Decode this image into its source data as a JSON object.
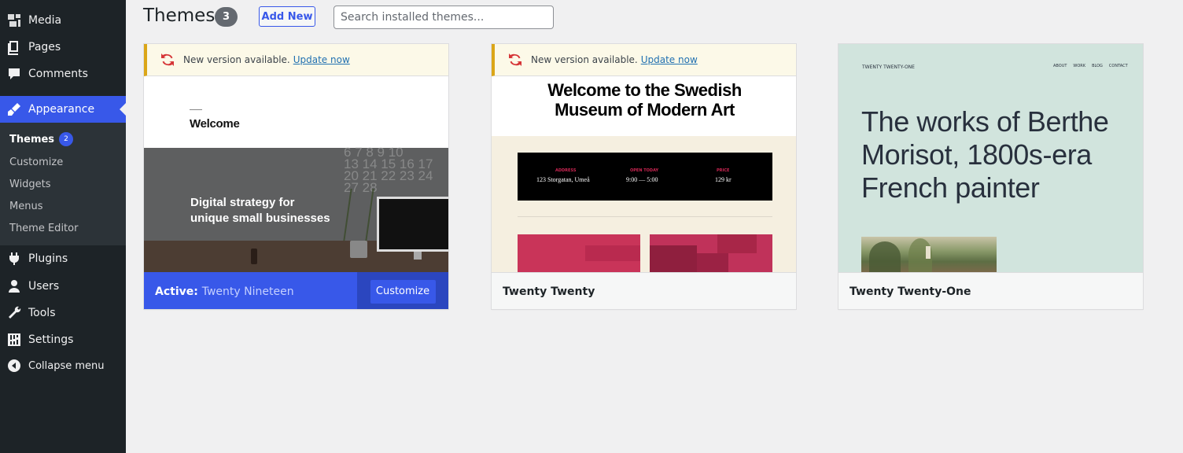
{
  "sidebar": {
    "items": [
      {
        "label": "Media",
        "icon": "media-icon"
      },
      {
        "label": "Pages",
        "icon": "pages-icon"
      },
      {
        "label": "Comments",
        "icon": "comments-icon"
      },
      {
        "label": "Appearance",
        "icon": "appearance-icon"
      },
      {
        "label": "Plugins",
        "icon": "plugins-icon"
      },
      {
        "label": "Users",
        "icon": "users-icon"
      },
      {
        "label": "Tools",
        "icon": "tools-icon"
      },
      {
        "label": "Settings",
        "icon": "settings-icon"
      },
      {
        "label": "Collapse menu",
        "icon": "collapse-icon"
      }
    ],
    "submenu": [
      {
        "label": "Themes",
        "badge": "2"
      },
      {
        "label": "Customize"
      },
      {
        "label": "Widgets"
      },
      {
        "label": "Menus"
      },
      {
        "label": "Theme Editor"
      }
    ]
  },
  "header": {
    "title": "Themes",
    "count": "3",
    "add_new": "Add New",
    "search_placeholder": "Search installed themes..."
  },
  "themes": [
    {
      "name": "Twenty Nineteen",
      "active_label": "Active:",
      "customize_label": "Customize",
      "notice_text": "New version available.",
      "notice_link": "Update now",
      "preview": {
        "heading": "Welcome",
        "hero_text_1": "Digital strategy for",
        "hero_text_2": "unique small businesses",
        "calendar_rows": [
          "6 7 8 9 10",
          "13 14 15 16 17",
          "20 21 22 23 24",
          "27 28"
        ]
      }
    },
    {
      "name": "Twenty Twenty",
      "notice_text": "New version available.",
      "notice_link": "Update now",
      "preview": {
        "heading_1": "Welcome to the Swedish",
        "heading_2": "Museum of Modern Art",
        "info_labels": [
          "ADDRESS",
          "OPEN TODAY",
          "PRICE"
        ],
        "info_values": [
          "123 Storgatan, Umeå",
          "9:00 — 5:00",
          "129 kr"
        ]
      }
    },
    {
      "name": "Twenty Twenty-One",
      "preview": {
        "site_title": "TWENTY TWENTY-ONE",
        "nav": [
          "ABOUT",
          "WORK",
          "BLOG",
          "CONTACT"
        ],
        "heading_1": "The works of Berthe",
        "heading_2": "Morisot, 1800s-era",
        "heading_3": "French painter"
      }
    }
  ],
  "colors": {
    "accent": "#3858e9",
    "sidebar_bg": "#1d2327",
    "notice_border": "#dba617",
    "update_icon": "#d63638"
  }
}
